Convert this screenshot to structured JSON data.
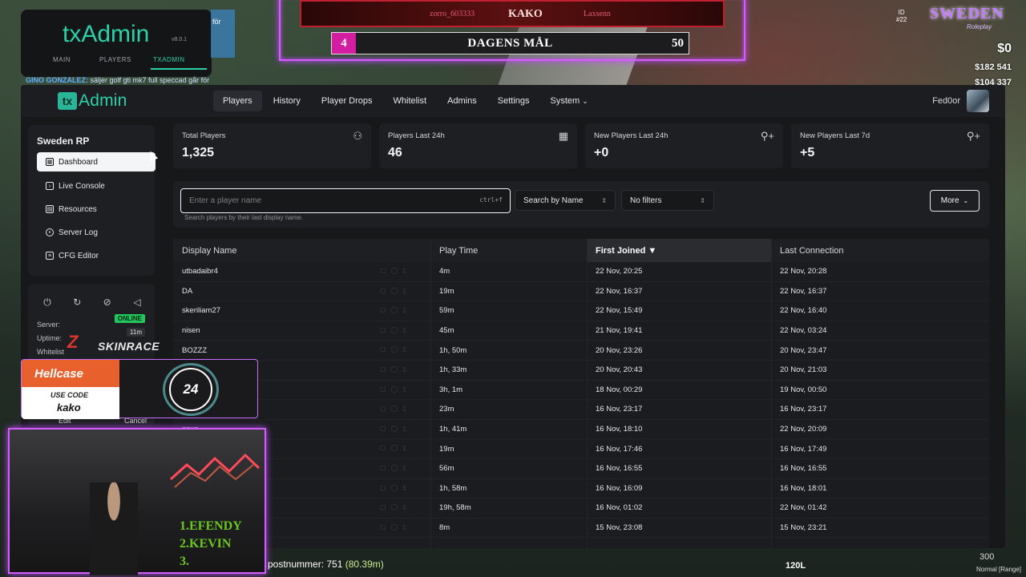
{
  "app": {
    "logo_badge": "tx",
    "logo_text": "Admin",
    "nav": [
      "Players",
      "History",
      "Player Drops",
      "Whitelist",
      "Admins",
      "Settings",
      "System"
    ],
    "active_nav": "Players",
    "system_chevron": "⌄",
    "user": "Fed0or"
  },
  "sidebar": {
    "server_name": "Sweden RP",
    "items": [
      {
        "label": "Dashboard",
        "icon": "dashboard-icon",
        "active": true
      },
      {
        "label": "Live Console",
        "icon": "console-icon",
        "active": false
      },
      {
        "label": "Resources",
        "icon": "resources-icon",
        "active": false
      },
      {
        "label": "Server Log",
        "icon": "eye-icon",
        "active": false
      },
      {
        "label": "CFG Editor",
        "icon": "file-icon",
        "active": false
      }
    ],
    "controls": [
      "power-off-icon",
      "restart-icon",
      "kick-all-icon",
      "announce-icon"
    ],
    "server_label": "Server:",
    "server_status": "ONLINE",
    "uptime_label": "Uptime:",
    "uptime_value": "11m",
    "whitelist_label": "Whitelist",
    "edit_label": "Edit",
    "cancel_label": "Cancel"
  },
  "stats": [
    {
      "label": "Total Players",
      "value": "1,325",
      "icon": "users-icon"
    },
    {
      "label": "Players Last 24h",
      "value": "46",
      "icon": "calendar-icon"
    },
    {
      "label": "New Players Last 24h",
      "value": "+0",
      "icon": "user-plus-icon"
    },
    {
      "label": "New Players Last 7d",
      "value": "+5",
      "icon": "user-plus-icon"
    }
  ],
  "search": {
    "placeholder": "Enter a player name",
    "shortcut": "ctrl+f",
    "hint": "Search players by their last display name.",
    "search_by": "Search by Name",
    "filters": "No filters",
    "more": "More"
  },
  "table": {
    "columns": [
      "Display Name",
      "Play Time",
      "First Joined ▼",
      "Last Connection"
    ],
    "sorted_column": 2,
    "rows": [
      {
        "name": "utbadaibr4",
        "play": "4m",
        "first": "22 Nov, 20:25",
        "last": "22 Nov, 20:28"
      },
      {
        "name": "DA",
        "play": "19m",
        "first": "22 Nov, 16:37",
        "last": "22 Nov, 16:37"
      },
      {
        "name": "skeriliam27",
        "play": "59m",
        "first": "22 Nov, 15:49",
        "last": "22 Nov, 16:40"
      },
      {
        "name": "nisen",
        "play": "45m",
        "first": "21 Nov, 19:41",
        "last": "22 Nov, 03:24"
      },
      {
        "name": "BOZZZ",
        "play": "1h, 50m",
        "first": "20 Nov, 23:26",
        "last": "20 Nov, 23:47"
      },
      {
        "name": "",
        "play": "1h, 33m",
        "first": "20 Nov, 20:43",
        "last": "20 Nov, 21:03"
      },
      {
        "name": "",
        "play": "3h, 1m",
        "first": "18 Nov, 00:29",
        "last": "19 Nov, 00:50"
      },
      {
        "name": "",
        "play": "23m",
        "first": "16 Nov, 23:17",
        "last": "16 Nov, 23:17"
      },
      {
        "name": "asus",
        "play": "1h, 41m",
        "first": "16 Nov, 18:10",
        "last": "22 Nov, 20:09"
      },
      {
        "name": "",
        "play": "19m",
        "first": "16 Nov, 17:46",
        "last": "16 Nov, 17:49"
      },
      {
        "name": "",
        "play": "56m",
        "first": "16 Nov, 16:55",
        "last": "16 Nov, 16:55"
      },
      {
        "name": "",
        "play": "1h, 58m",
        "first": "16 Nov, 16:09",
        "last": "16 Nov, 18:01"
      },
      {
        "name": "",
        "play": "19h, 58m",
        "first": "16 Nov, 01:02",
        "last": "22 Nov, 01:42"
      },
      {
        "name": "",
        "play": "8m",
        "first": "15 Nov, 23:08",
        "last": "15 Nov, 23:21"
      }
    ]
  },
  "overlay": {
    "logo_title": "txAdmin",
    "version": "v8.0.1",
    "tabs": [
      "MAIN",
      "PLAYERS",
      "TXADMIN"
    ],
    "side_text": "för",
    "twitch_user": "GINO GONZALEZ:",
    "twitch_text": "säljer golf gti mk7 full speccad går för",
    "goal_user1": "zorro_603333",
    "goal_center": "KAKO",
    "goal_user2": "Laxsenn",
    "goal_num": "4",
    "goal_title": "DAGENS MÅL",
    "goal_target": "50",
    "brand_logo": "SWEDEN",
    "brand_sub": "Roleplay",
    "hud_id_label": "ID",
    "hud_id": "#22",
    "cash": "$0",
    "bank": "$182 541",
    "dirty": "$104 337",
    "skinrace": "SKINRACE",
    "hellcase": "Hellcase",
    "use_code": "USE CODE",
    "code": "kako",
    "timer": "24",
    "ranking": [
      "1.EFENDY",
      "2.KEVIN",
      "3."
    ],
    "post_label": "postnummer:",
    "post_value": "751",
    "post_dist": "(80.39m)",
    "speed": "120L",
    "speed_max": "300",
    "speed_mode": "Normal [Range]"
  },
  "colors": {
    "accent": "#2bd1a8",
    "online": "#22c55e",
    "neon": "#d65cff"
  }
}
